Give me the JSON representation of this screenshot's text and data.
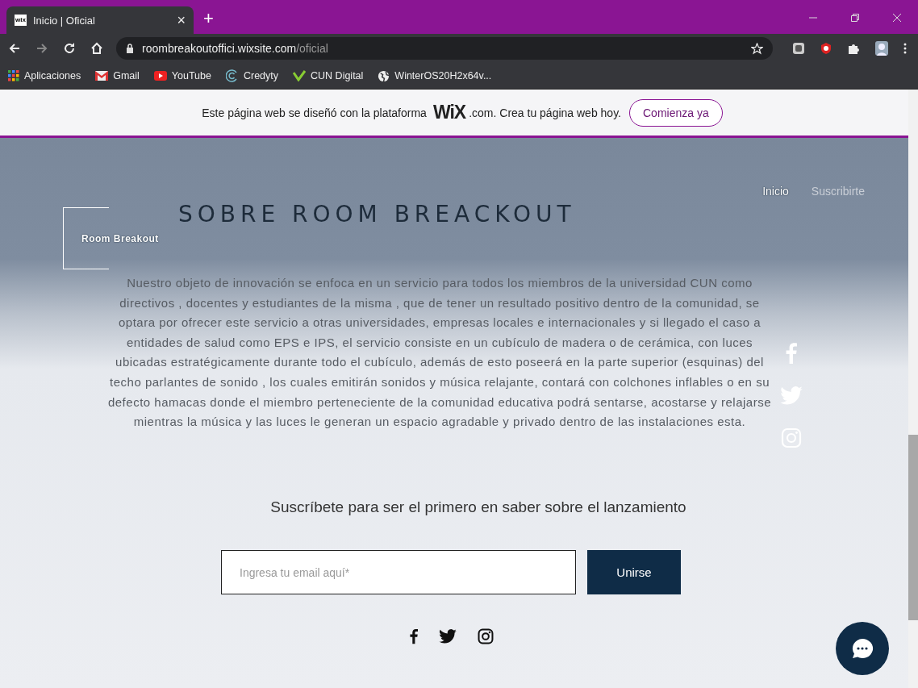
{
  "browser": {
    "tab": {
      "favicon": "wix",
      "title": "Inicio | Oficial",
      "close": "×"
    },
    "new_tab": "+",
    "address": {
      "host": "roombreakoutoffici.wixsite.com",
      "path": "/oficial"
    },
    "bookmarks": [
      {
        "kind": "apps",
        "label": "Aplicaciones"
      },
      {
        "kind": "gmail",
        "label": "Gmail"
      },
      {
        "kind": "youtube",
        "label": "YouTube"
      },
      {
        "kind": "credyty",
        "label": "Credyty"
      },
      {
        "kind": "cun",
        "label": "CUN Digital"
      },
      {
        "kind": "globe",
        "label": "WinterOS20H2x64v..."
      }
    ]
  },
  "wix_banner": {
    "text_start": "Este página web se diseñó con la plataforma",
    "logo": "WiX",
    "text_end": ".com. Crea tu página web hoy.",
    "button": "Comienza ya"
  },
  "site": {
    "logo": "Room Breakout",
    "title": "SOBRE ROOM BREACKOUT",
    "nav": [
      {
        "label": "Inicio",
        "selected": true
      },
      {
        "label": "Suscribirte",
        "selected": false
      }
    ],
    "paragraph": "Nuestro objeto de innovación se enfoca en un servicio para todos los miembros de la universidad CUN como directivos , docentes y estudiantes de la misma , que de tener un resultado positivo dentro de la comunidad, se optara por ofrecer este servicio a otras universidades, empresas locales e internacionales y si llegado el caso a entidades de salud como EPS e IPS, el servicio consiste en un cubículo de madera o de cerámica, con luces ubicadas estratégicamente durante todo el cubículo, además de esto poseerá en la parte superior (esquinas) del techo parlantes de sonido , los cuales emitirán sonidos y música relajante, contará con colchones inflables o en su defecto hamacas donde el miembro perteneciente de la comunidad educativa podrá sentarse, acostarse y relajarse mientras la música y las luces le generan un espacio agradable y privado dentro de las instalaciones esta.",
    "subscribe_heading": "Suscríbete para ser el primero en saber sobre el lanzamiento",
    "email": {
      "placeholder": "Ingresa tu email aquí*"
    },
    "join_button": "Unirse"
  }
}
